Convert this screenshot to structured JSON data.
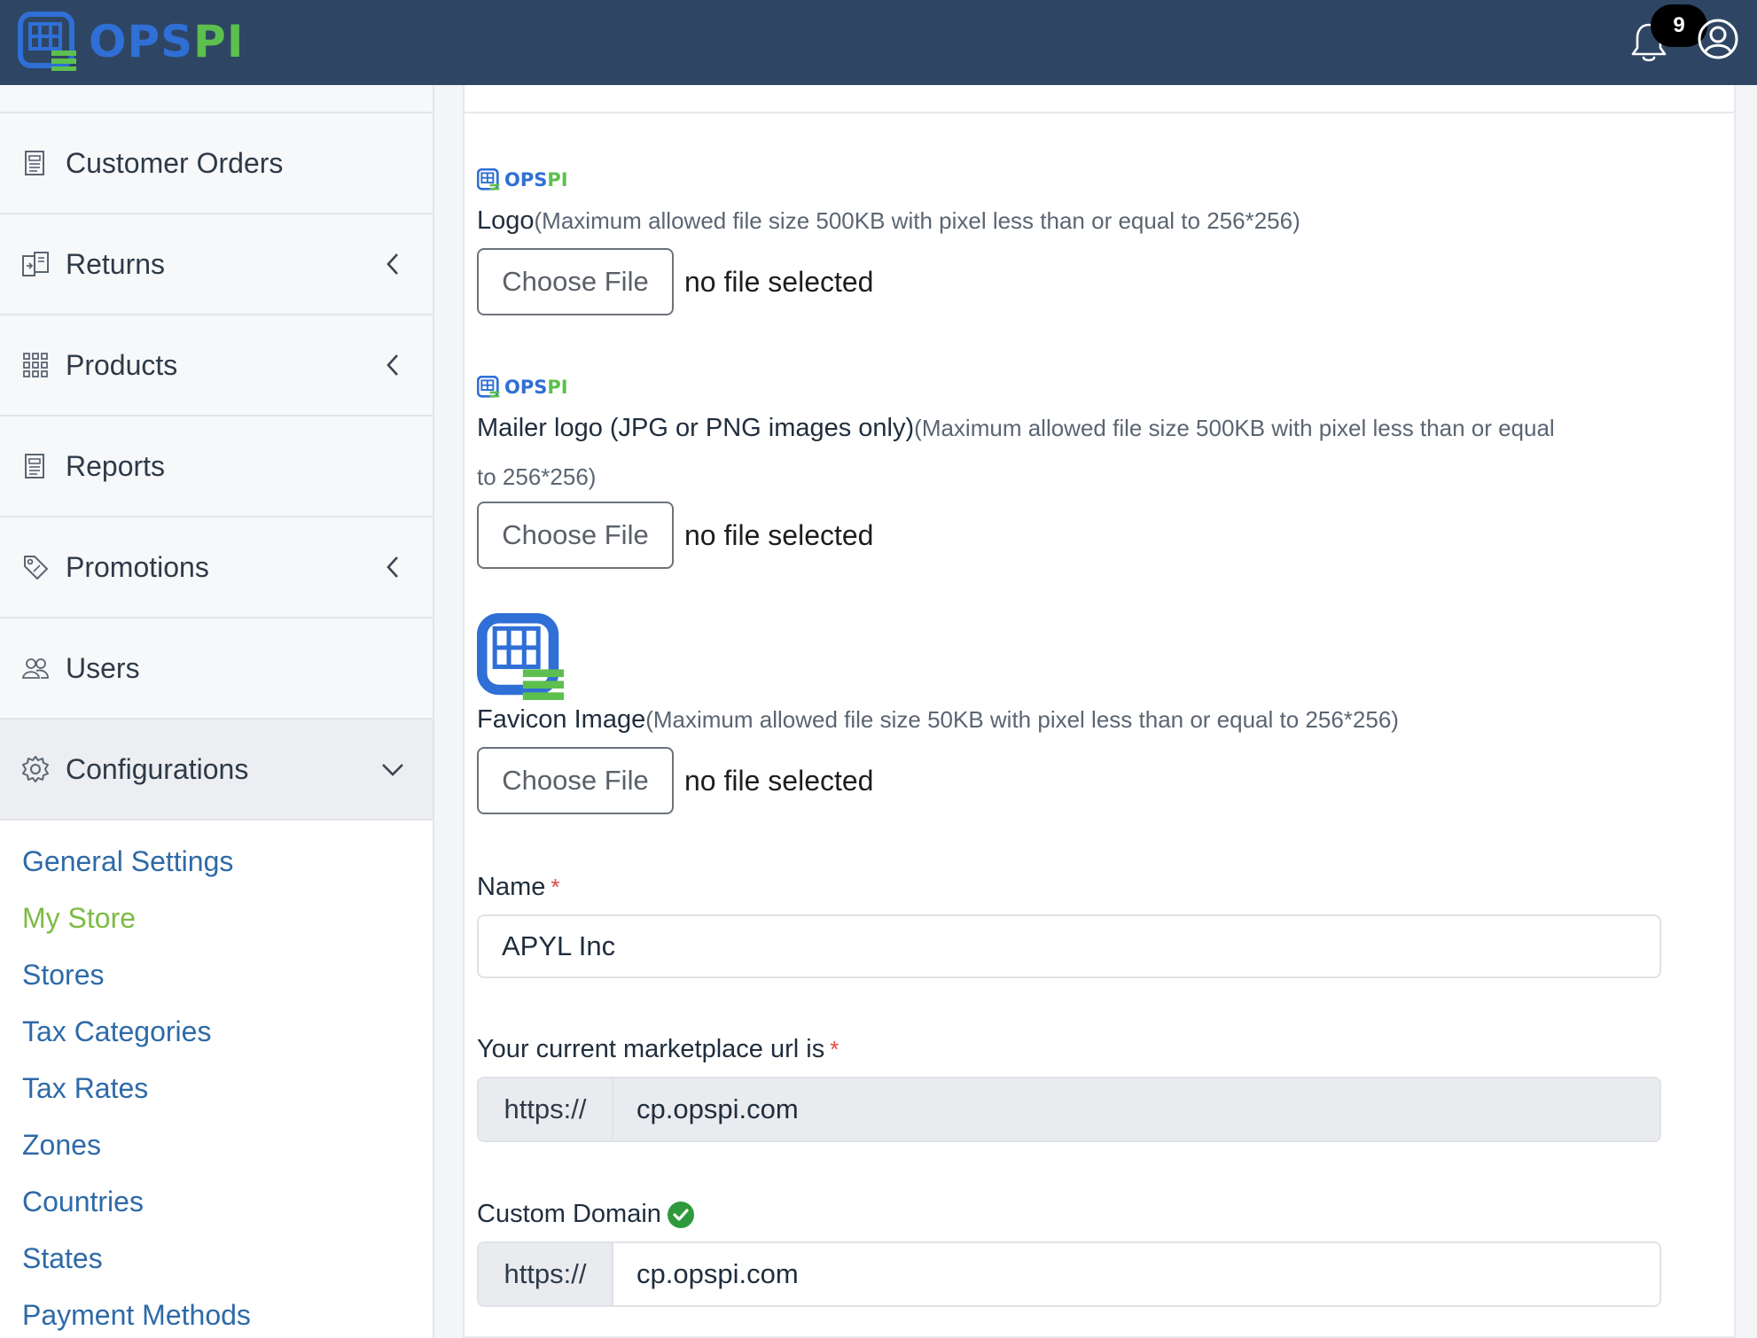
{
  "brand": {
    "name_part1": "OPS",
    "name_part2": "PI",
    "color_primary": "#2f6fd6",
    "color_secondary": "#5cbf4e"
  },
  "header": {
    "notification_count": "9",
    "bell_icon": "bell-icon",
    "user_icon": "user-circle-icon"
  },
  "sidebar": {
    "items": [
      {
        "label": "Customer Orders",
        "icon": "document-icon"
      },
      {
        "label": "Returns",
        "icon": "returns-icon"
      },
      {
        "label": "Products",
        "icon": "grid-icon"
      },
      {
        "label": "Reports",
        "icon": "document-icon"
      },
      {
        "label": "Promotions",
        "icon": "tag-icon"
      },
      {
        "label": "Users",
        "icon": "users-icon"
      },
      {
        "label": "Configurations",
        "icon": "gear-icon"
      }
    ],
    "submenu": [
      {
        "label": "General Settings"
      },
      {
        "label": "My Store"
      },
      {
        "label": "Stores"
      },
      {
        "label": "Tax Categories"
      },
      {
        "label": "Tax Rates"
      },
      {
        "label": "Zones"
      },
      {
        "label": "Countries"
      },
      {
        "label": "States"
      },
      {
        "label": "Payment Methods"
      }
    ]
  },
  "form": {
    "logo": {
      "preview_part1": "OPS",
      "preview_part2": "PI",
      "label": "Logo",
      "note": "(Maximum allowed file size 500KB with pixel less than or equal to 256*256)",
      "button": "Choose File",
      "status": "no file selected"
    },
    "mailer_logo": {
      "preview_part1": "OPS",
      "preview_part2": "PI",
      "label": "Mailer logo (JPG or PNG images only)",
      "note_line1": "(Maximum allowed file size 500KB with pixel less than or equal",
      "note_line2": "to 256*256)",
      "button": "Choose File",
      "status": "no file selected"
    },
    "favicon": {
      "label": "Favicon Image",
      "note": "(Maximum allowed file size 50KB with pixel less than or equal to 256*256)",
      "button": "Choose File",
      "status": "no file selected"
    },
    "name": {
      "label": "Name",
      "required_mark": "*",
      "value": "APYL Inc"
    },
    "marketplace_url": {
      "label": "Your current marketplace url is",
      "required_mark": "*",
      "prefix": "https://",
      "value": "cp.opspi.com"
    },
    "custom_domain": {
      "label": "Custom Domain",
      "prefix": "https://",
      "value": "cp.opspi.com",
      "verified_color": "#2e9a3c"
    }
  }
}
